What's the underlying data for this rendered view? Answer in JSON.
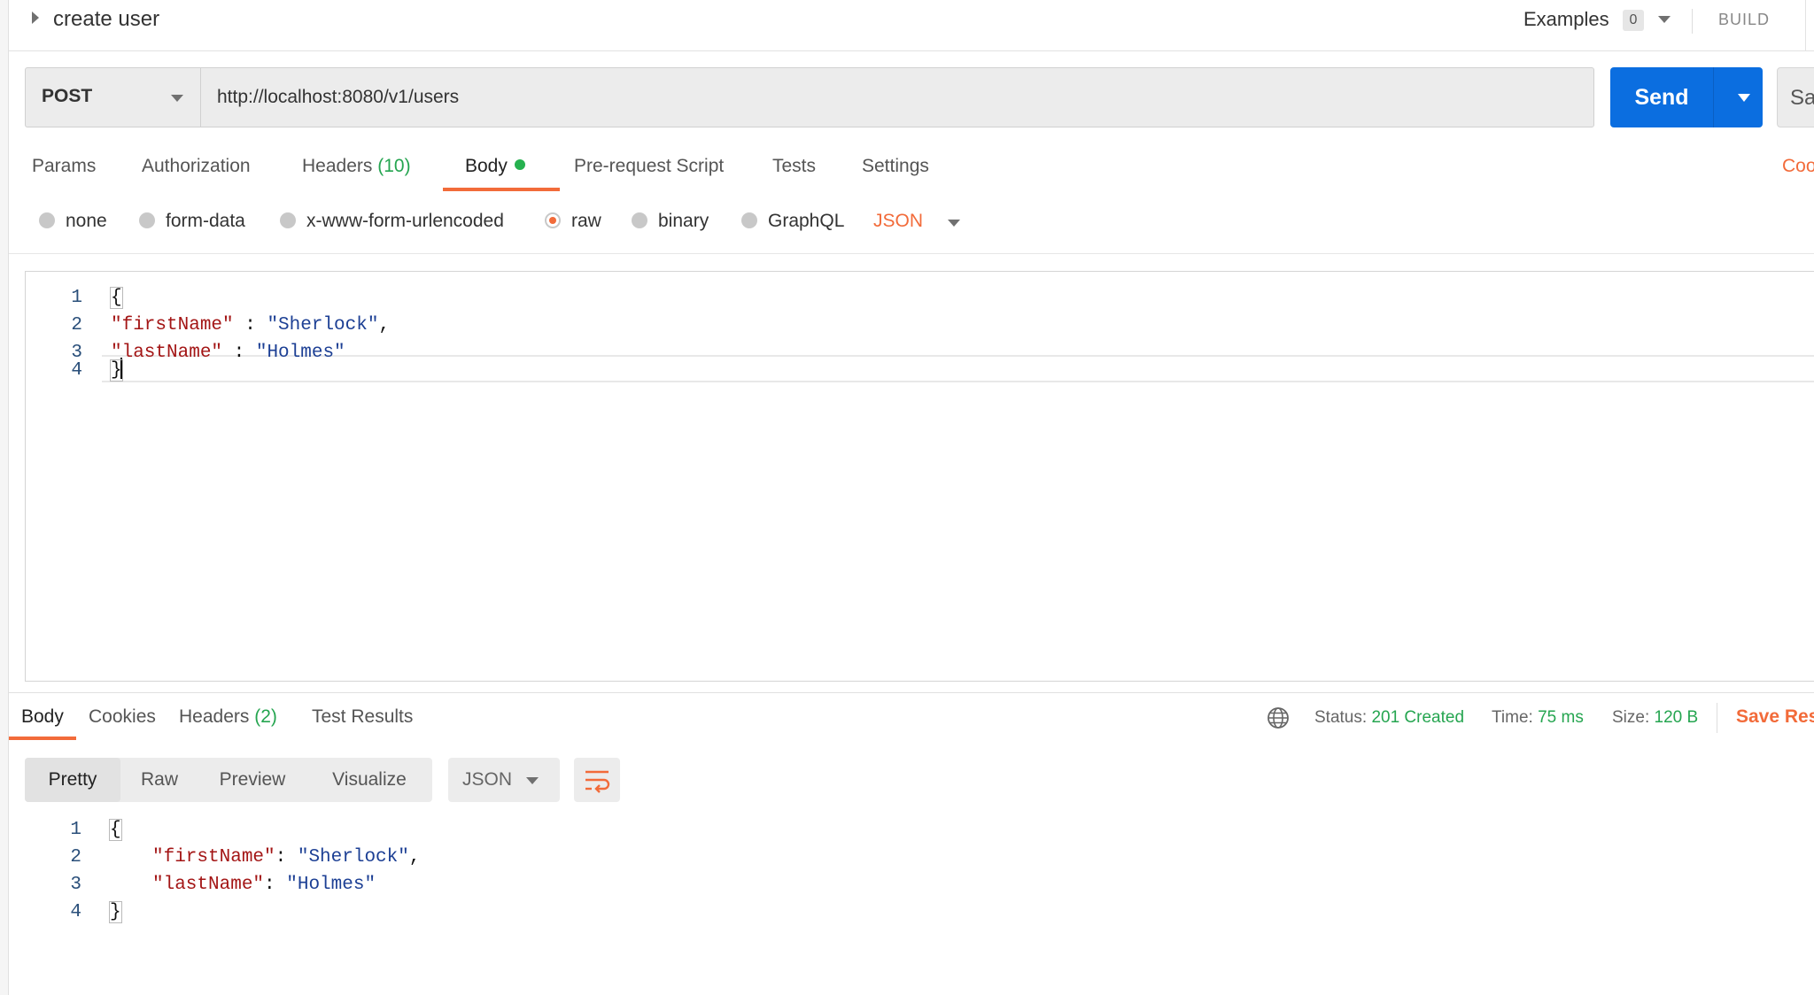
{
  "title_bar": {
    "request_name": "create user",
    "examples_label": "Examples",
    "examples_count": "0",
    "build_label": "BUILD"
  },
  "request": {
    "method": "POST",
    "url": "http://localhost:8080/v1/users",
    "send_label": "Send",
    "save_label": "Sa"
  },
  "request_tabs": {
    "params": "Params",
    "authorization": "Authorization",
    "headers": "Headers",
    "headers_count": "(10)",
    "body": "Body",
    "pre_request": "Pre-request Script",
    "tests": "Tests",
    "settings": "Settings",
    "cookies": "Cook"
  },
  "body_types": {
    "none": "none",
    "form_data": "form-data",
    "urlencoded": "x-www-form-urlencoded",
    "raw": "raw",
    "binary": "binary",
    "graphql": "GraphQL",
    "format": "JSON",
    "selected": "raw"
  },
  "request_body": {
    "line_numbers": [
      "1",
      "2",
      "3",
      "4"
    ],
    "open_brace": "{",
    "first_key": "\"firstName\"",
    "first_sep": " : ",
    "first_value": "\"Sherlock\"",
    "first_comma": ",",
    "last_key": "\"lastName\"",
    "last_sep": " : ",
    "last_value": "\"Holmes\"",
    "close_brace": "}"
  },
  "response_tabs": {
    "body": "Body",
    "cookies": "Cookies",
    "headers": "Headers",
    "headers_count": "(2)",
    "test_results": "Test Results"
  },
  "response_status": {
    "status_label": "Status:",
    "status_value": "201 Created",
    "time_label": "Time:",
    "time_value": "75 ms",
    "size_label": "Size:",
    "size_value": "120 B",
    "save_response": "Save Res"
  },
  "response_view": {
    "pretty": "Pretty",
    "raw": "Raw",
    "preview": "Preview",
    "visualize": "Visualize",
    "format": "JSON"
  },
  "response_body": {
    "line_numbers": [
      "1",
      "2",
      "3",
      "4"
    ],
    "open_brace": "{",
    "first_key": "\"firstName\"",
    "first_sep": ": ",
    "first_value": "\"Sherlock\"",
    "first_comma": ",",
    "last_key": "\"lastName\"",
    "last_sep": ": ",
    "last_value": "\"Holmes\"",
    "close_brace": "}"
  },
  "colors": {
    "accent": "#f26b3a",
    "send_blue": "#0b6ee0",
    "success_green": "#25a550",
    "json_key": "#a31515",
    "json_string": "#1c3f94"
  }
}
